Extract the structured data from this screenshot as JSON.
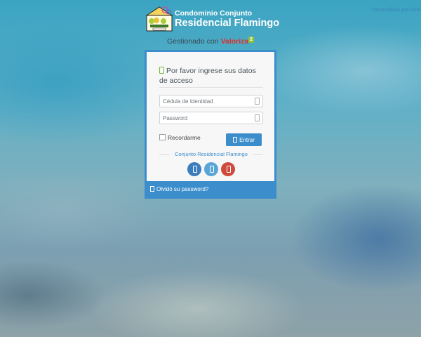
{
  "credit": "Desarrollado por Rom",
  "brand": {
    "line1": "Condominio Conjunto",
    "line2": "Residencial Flamingo"
  },
  "managed": {
    "prefix": "Gestionado con",
    "product": "Valoriza",
    "badge": "2"
  },
  "login": {
    "title": "Por favor ingrese sus datos de acceso",
    "id_placeholder": "Cédula de Identidad",
    "id_value": "",
    "password_placeholder": "Password",
    "password_value": "",
    "remember_label": "Recordarme",
    "remember_checked": false,
    "submit_label": "Entrar",
    "condo_name": "Conjunto Residencial Flamingo",
    "forgot_label": "Olvidó su password?"
  },
  "colors": {
    "accent": "#3c8dcb",
    "social1": "#3c7dbd",
    "social2": "#5aa5d8",
    "social3": "#cf4a3c",
    "icon_green": "#7cba3a",
    "brand_red": "#d9322b"
  },
  "icons": {
    "title": "document-icon",
    "id_field": "id-card-icon",
    "password_field": "lock-icon",
    "submit": "login-icon",
    "social": [
      "facebook-icon",
      "twitter-icon",
      "google-plus-icon"
    ],
    "forgot": "key-icon"
  }
}
